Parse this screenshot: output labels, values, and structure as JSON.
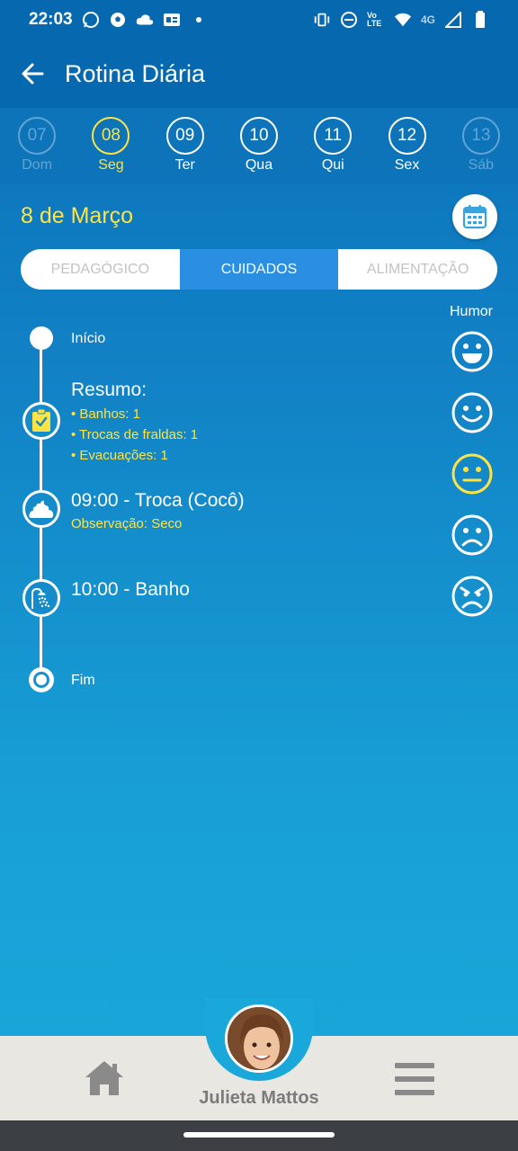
{
  "status_bar": {
    "time": "22:03",
    "network_label": "4G",
    "volte_label": "Vo LTE"
  },
  "app_bar": {
    "title": "Rotina Diária"
  },
  "date_strip": [
    {
      "num": "07",
      "weekday": "Dom",
      "state": "dim"
    },
    {
      "num": "08",
      "weekday": "Seg",
      "state": "active"
    },
    {
      "num": "09",
      "weekday": "Ter",
      "state": "normal"
    },
    {
      "num": "10",
      "weekday": "Qua",
      "state": "normal"
    },
    {
      "num": "11",
      "weekday": "Qui",
      "state": "normal"
    },
    {
      "num": "12",
      "weekday": "Sex",
      "state": "normal"
    },
    {
      "num": "13",
      "weekday": "Sáb",
      "state": "dim"
    }
  ],
  "date_title": "8 de Março",
  "tabs": [
    {
      "label": "PEDAGÓGICO",
      "active": false
    },
    {
      "label": "CUIDADOS",
      "active": true
    },
    {
      "label": "ALIMENTAÇÃO",
      "active": false
    }
  ],
  "humor": {
    "label": "Humor",
    "moods": [
      "very-happy-icon",
      "happy-icon",
      "neutral-icon",
      "sad-icon",
      "angry-icon"
    ],
    "selected": "neutral-icon",
    "selected_color": "#ffe342"
  },
  "timeline": {
    "start_label": "Início",
    "summary": {
      "title": "Resumo:",
      "items": [
        "• Banhos: 1",
        "• Trocas de fraldas: 1",
        "• Evacuações: 1"
      ]
    },
    "events": [
      {
        "title": "09:00 - Troca (Cocô)",
        "note": "Observação: Seco",
        "icon": "poop-icon"
      },
      {
        "title": "10:00 - Banho",
        "note": "",
        "icon": "shower-icon"
      }
    ],
    "end_label": "Fim"
  },
  "bottom_nav": {
    "child_name": "Julieta Mattos"
  },
  "colors": {
    "accent": "#ffe342",
    "tab_active": "#2a8fe0",
    "app_bar": "#0668ae"
  }
}
